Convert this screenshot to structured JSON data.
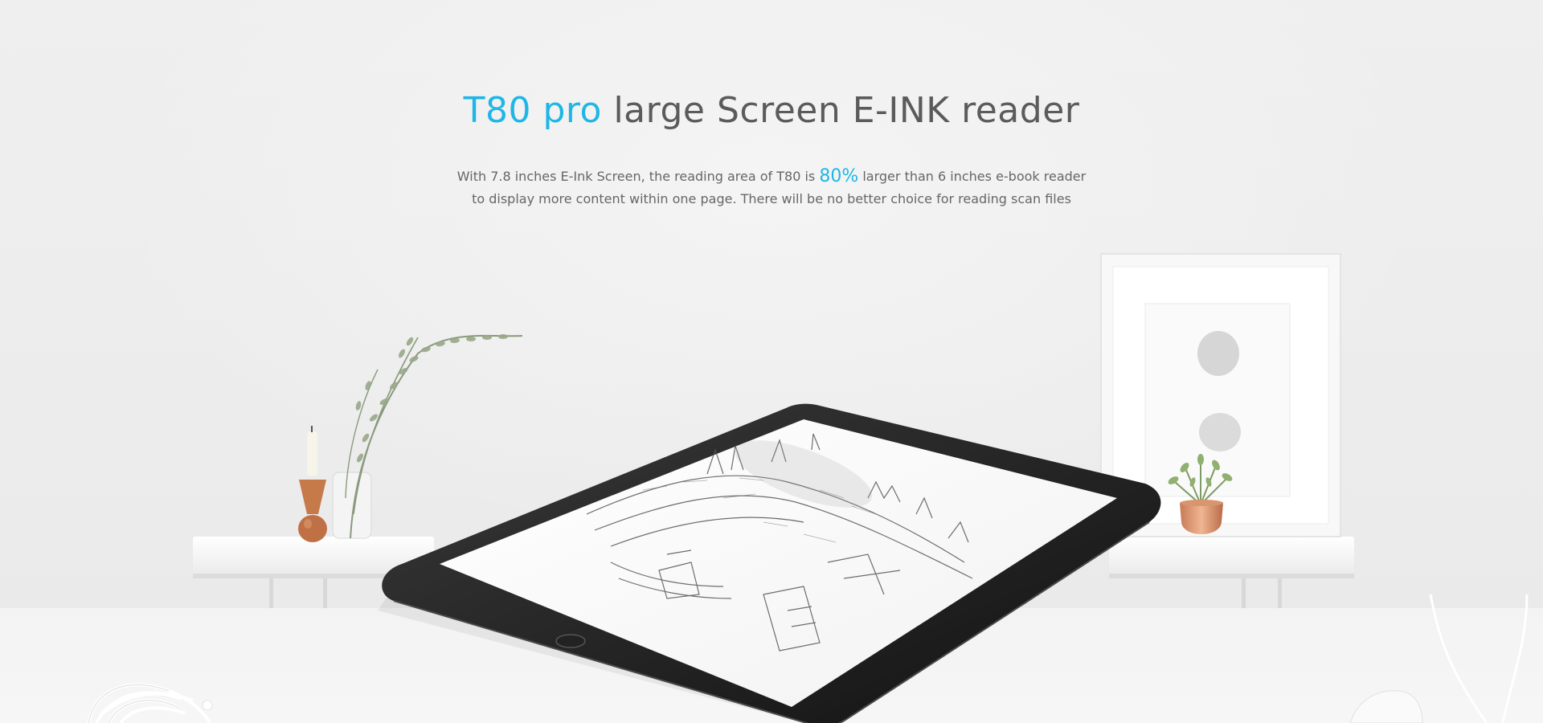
{
  "theme": {
    "accent": "#1fb6e6"
  },
  "hero": {
    "title_accent": "T80 pro",
    "title_rest": " large Screen E-INK reader",
    "line1_pre": "With 7.8 inches E-Ink Screen, the reading area of T80 is ",
    "line1_pct": "80%",
    "line1_post": " larger than 6 inches e-book reader",
    "line2": "to display more content within one page. There will be no better choice for reading scan files"
  }
}
